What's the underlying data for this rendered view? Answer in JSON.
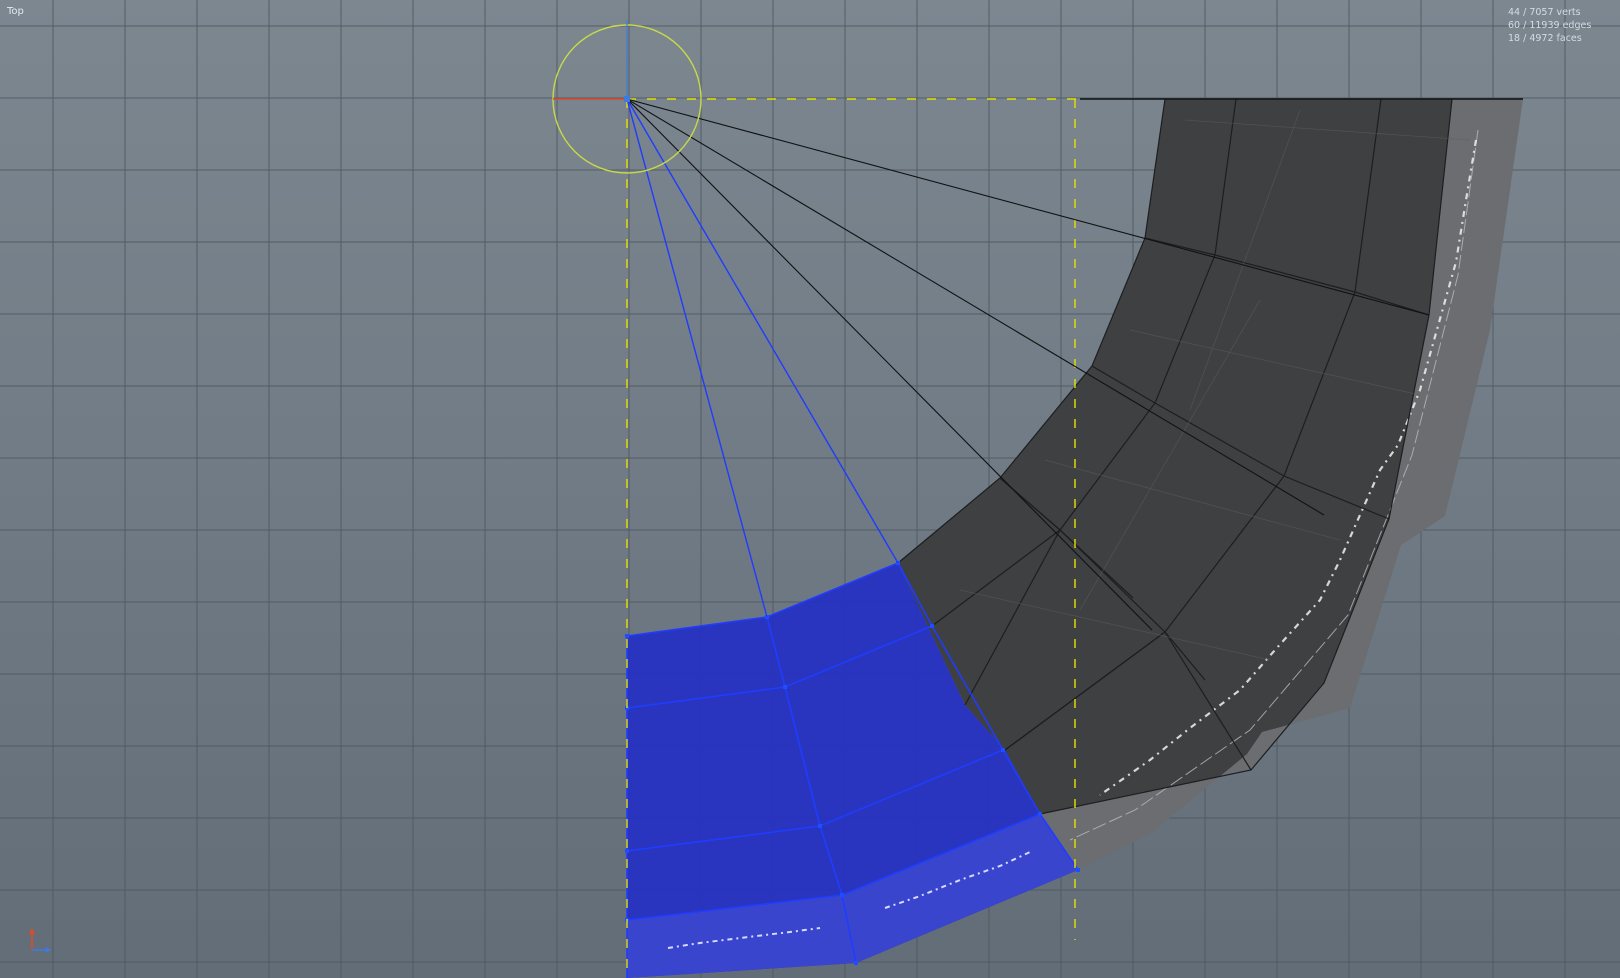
{
  "viewport": {
    "view_label": "Top",
    "stats": {
      "verts": "44 / 7057 verts",
      "edges": "60 / 11939 edges",
      "faces": "18 / 4972 faces"
    }
  },
  "icons": {
    "axis_gizmo": "axis-gizmo-icon",
    "rotation_gizmo": "rotate-gizmo-icon"
  },
  "colors": {
    "grid_line": "#4f5961",
    "mesh_dark": "#3d3f41",
    "mesh_rim": "#6b6d70",
    "selection_blue": "#1e2ab4",
    "selection_edge": "#1a3cff",
    "gizmo_yellow": "#c8d84a",
    "guide_yellow": "#e6e200",
    "axis_x": "#e04a2a",
    "axis_y": "#3c7be0"
  }
}
